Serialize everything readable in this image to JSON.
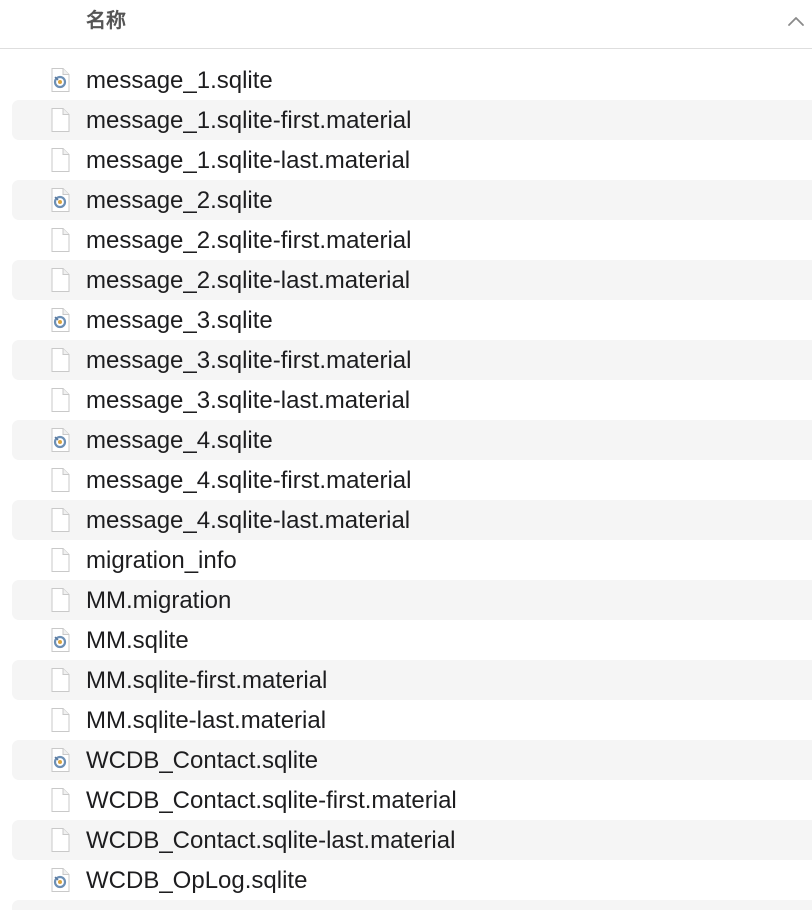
{
  "header": {
    "column_name": "名称",
    "sort_icon": "chevron-up-icon"
  },
  "files": [
    {
      "name": "message_1.sqlite",
      "icon": "sqlite-db-icon"
    },
    {
      "name": "message_1.sqlite-first.material",
      "icon": "document-icon"
    },
    {
      "name": "message_1.sqlite-last.material",
      "icon": "document-icon"
    },
    {
      "name": "message_2.sqlite",
      "icon": "sqlite-db-icon"
    },
    {
      "name": "message_2.sqlite-first.material",
      "icon": "document-icon"
    },
    {
      "name": "message_2.sqlite-last.material",
      "icon": "document-icon"
    },
    {
      "name": "message_3.sqlite",
      "icon": "sqlite-db-icon"
    },
    {
      "name": "message_3.sqlite-first.material",
      "icon": "document-icon"
    },
    {
      "name": "message_3.sqlite-last.material",
      "icon": "document-icon"
    },
    {
      "name": "message_4.sqlite",
      "icon": "sqlite-db-icon"
    },
    {
      "name": "message_4.sqlite-first.material",
      "icon": "document-icon"
    },
    {
      "name": "message_4.sqlite-last.material",
      "icon": "document-icon"
    },
    {
      "name": "migration_info",
      "icon": "document-icon"
    },
    {
      "name": "MM.migration",
      "icon": "document-icon"
    },
    {
      "name": "MM.sqlite",
      "icon": "sqlite-db-icon"
    },
    {
      "name": "MM.sqlite-first.material",
      "icon": "document-icon"
    },
    {
      "name": "MM.sqlite-last.material",
      "icon": "document-icon"
    },
    {
      "name": "WCDB_Contact.sqlite",
      "icon": "sqlite-db-icon"
    },
    {
      "name": "WCDB_Contact.sqlite-first.material",
      "icon": "document-icon"
    },
    {
      "name": "WCDB_Contact.sqlite-last.material",
      "icon": "document-icon"
    },
    {
      "name": "WCDB_OpLog.sqlite",
      "icon": "sqlite-db-icon"
    },
    {
      "name": "",
      "icon": ""
    }
  ],
  "colors": {
    "alt_row": "#f5f5f5",
    "text": "#1d1d1f",
    "header_text": "#555555",
    "divider": "#dedede"
  }
}
